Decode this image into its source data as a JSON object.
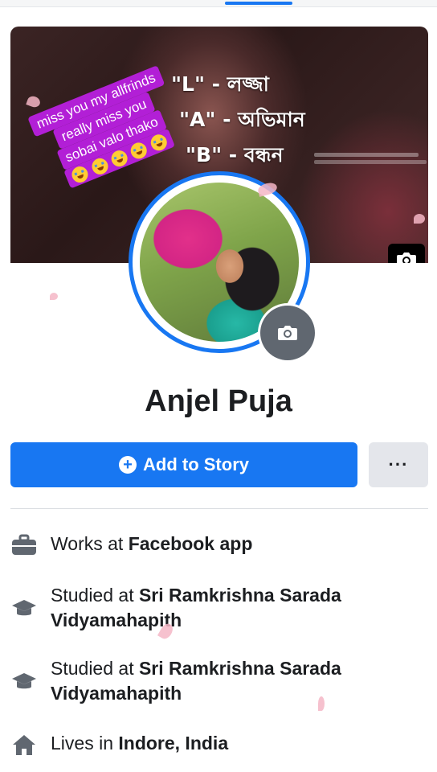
{
  "cover": {
    "lines": [
      "\"L\" - লজ্জা",
      "\"A\" - অভিমান",
      "\"B\" - বন্ধন"
    ],
    "camera_icon": "camera-icon"
  },
  "sticker": {
    "lines": [
      "miss you my allfrinds",
      "really miss you",
      "sobai valo thako"
    ],
    "emoji_icon": "crying-face-emoji"
  },
  "profile": {
    "name": "Anjel Puja",
    "avatar_camera_icon": "camera-icon"
  },
  "actions": {
    "add_story_label": "Add to Story",
    "more_label": "···"
  },
  "details": [
    {
      "icon": "briefcase-icon",
      "prefix": "Works at ",
      "value": "Facebook app"
    },
    {
      "icon": "graduation-cap-icon",
      "prefix": "Studied at ",
      "value": "Sri Ramkrishna Sarada Vidyamahapith"
    },
    {
      "icon": "graduation-cap-icon",
      "prefix": "Studied at ",
      "value": "Sri Ramkrishna Sarada Vidyamahapith"
    },
    {
      "icon": "home-icon",
      "prefix": "Lives in ",
      "value": "Indore, India"
    }
  ],
  "colors": {
    "accent": "#1877f2",
    "sticker": "#b21fd6"
  }
}
